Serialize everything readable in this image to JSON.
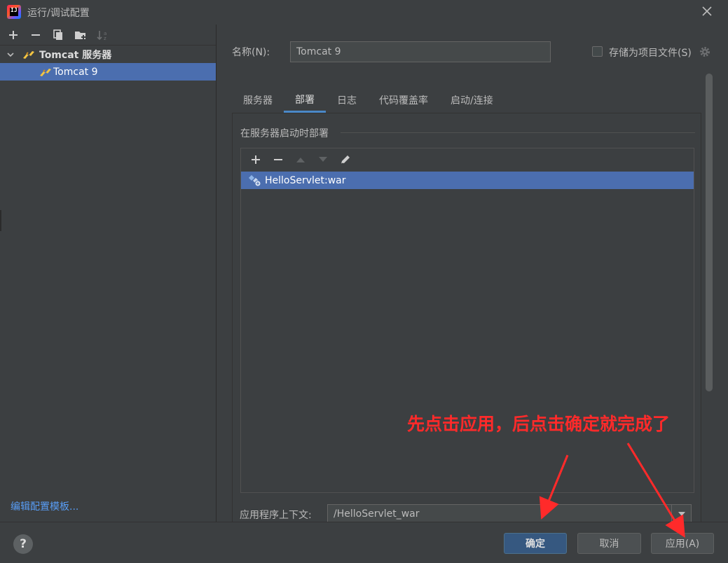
{
  "window": {
    "title": "运行/调试配置",
    "app_logo_text": "IJ"
  },
  "left": {
    "toolbar_icons": [
      "add-icon",
      "remove-icon",
      "copy-icon",
      "folder-add-icon",
      "sort-icon"
    ],
    "tree": {
      "group_label": "Tomcat 服务器",
      "items": [
        {
          "label": "Tomcat 9",
          "selected": true
        }
      ]
    },
    "edit_templates_link": "编辑配置模板..."
  },
  "config": {
    "name_label": "名称(N):",
    "name_value": "Tomcat 9",
    "store_as_file_label": "存储为项目文件(S)",
    "store_as_file_checked": false,
    "tabs": [
      {
        "label": "服务器",
        "active": false
      },
      {
        "label": "部署",
        "active": true
      },
      {
        "label": "日志",
        "active": false
      },
      {
        "label": "代码覆盖率",
        "active": false
      },
      {
        "label": "启动/连接",
        "active": false
      }
    ],
    "deploy_section_title": "在服务器启动时部署",
    "deploy_toolbar_icons": [
      "add-icon",
      "remove-icon",
      "move-up-icon",
      "move-down-icon",
      "edit-icon"
    ],
    "deploy_items": [
      {
        "label": "HelloServlet:war",
        "selected": true
      }
    ],
    "context_label": "应用程序上下文:",
    "context_value": "/HelloServlet_war"
  },
  "footer": {
    "help_label": "?",
    "ok_label": "确定",
    "cancel_label": "取消",
    "apply_label": "应用(A)"
  },
  "annotation": {
    "text": "先点击应用，后点击确定就完成了",
    "color": "#ff2a2a"
  },
  "colors": {
    "background": "#3c3f41",
    "selection": "#4b6eaf",
    "primary_button": "#365880",
    "link": "#589df6"
  }
}
